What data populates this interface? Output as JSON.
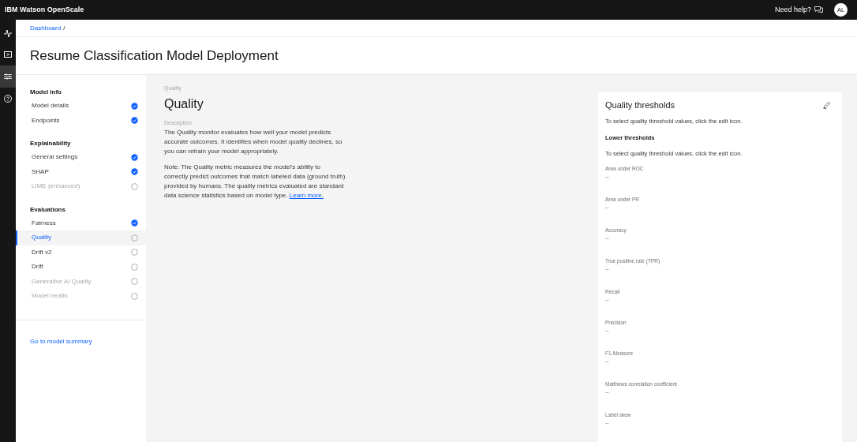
{
  "header": {
    "product": "IBM Watson OpenScale",
    "help": "Need help?",
    "avatar": "AL"
  },
  "rail": [
    {
      "kind": "activity",
      "selected": false
    },
    {
      "kind": "media",
      "selected": false
    },
    {
      "kind": "sliders",
      "selected": true
    },
    {
      "kind": "help",
      "selected": false
    }
  ],
  "breadcrumb": "Dashboard",
  "breadcrumb_separator": "/",
  "page_title": "Resume Classification Model Deployment",
  "sidebar": {
    "sections": [
      {
        "title": "Model info",
        "items": [
          {
            "label": "Model details",
            "checked": true,
            "disabled": false,
            "selected": false
          },
          {
            "label": "Endpoints",
            "checked": true,
            "disabled": false,
            "selected": false
          }
        ]
      },
      {
        "title": "Explainability",
        "items": [
          {
            "label": "General settings",
            "checked": true,
            "disabled": false,
            "selected": false
          },
          {
            "label": "SHAP",
            "checked": true,
            "disabled": false,
            "selected": false
          },
          {
            "label": "LIME (enhanced)",
            "checked": false,
            "disabled": true,
            "selected": false
          }
        ]
      },
      {
        "title": "Evaluations",
        "items": [
          {
            "label": "Fairness",
            "checked": true,
            "disabled": false,
            "selected": false
          },
          {
            "label": "Quality",
            "checked": false,
            "disabled": false,
            "selected": true
          },
          {
            "label": "Drift v2",
            "checked": false,
            "disabled": false,
            "selected": false
          },
          {
            "label": "Drift",
            "checked": false,
            "disabled": false,
            "selected": false
          },
          {
            "label": "Generative AI Quality",
            "checked": false,
            "disabled": true,
            "selected": false
          },
          {
            "label": "Model health",
            "checked": false,
            "disabled": true,
            "selected": false
          }
        ]
      }
    ],
    "footer_link": "Go to model summary"
  },
  "main": {
    "eyebrow": "Quality",
    "title": "Quality",
    "description_label": "Description",
    "description": "The Quality monitor evaluates how well your model predicts accurate outcomes. It identifies when model quality declines, so you can retrain your model appropriately.",
    "note": "Note: The Quality metric measures the model's ability to correctly predict outcomes that match labeled data (ground truth) provided by humans. The quality metrics evaluated are standard data science statistics based on model type.",
    "link": "Learn more."
  },
  "thresholds": {
    "title": "Quality thresholds",
    "hint": "To select quality threshold values, click the edit icon.",
    "lower_title": "Lower thresholds",
    "lower_hint": "To select quality threshold values, click the edit icon.",
    "metrics": [
      {
        "label": "Area under ROC",
        "value": "--"
      },
      {
        "label": "Area under PR",
        "value": "--"
      },
      {
        "label": "Accuracy",
        "value": "--"
      },
      {
        "label": "True positive rate (TPR)",
        "value": "--"
      },
      {
        "label": "Recall",
        "value": "--"
      },
      {
        "label": "Precision",
        "value": "--"
      },
      {
        "label": "F1-Measure",
        "value": "--"
      },
      {
        "label": "Matthews correlation coefficient",
        "value": "--"
      },
      {
        "label": "Label skew",
        "value": "--"
      }
    ]
  }
}
